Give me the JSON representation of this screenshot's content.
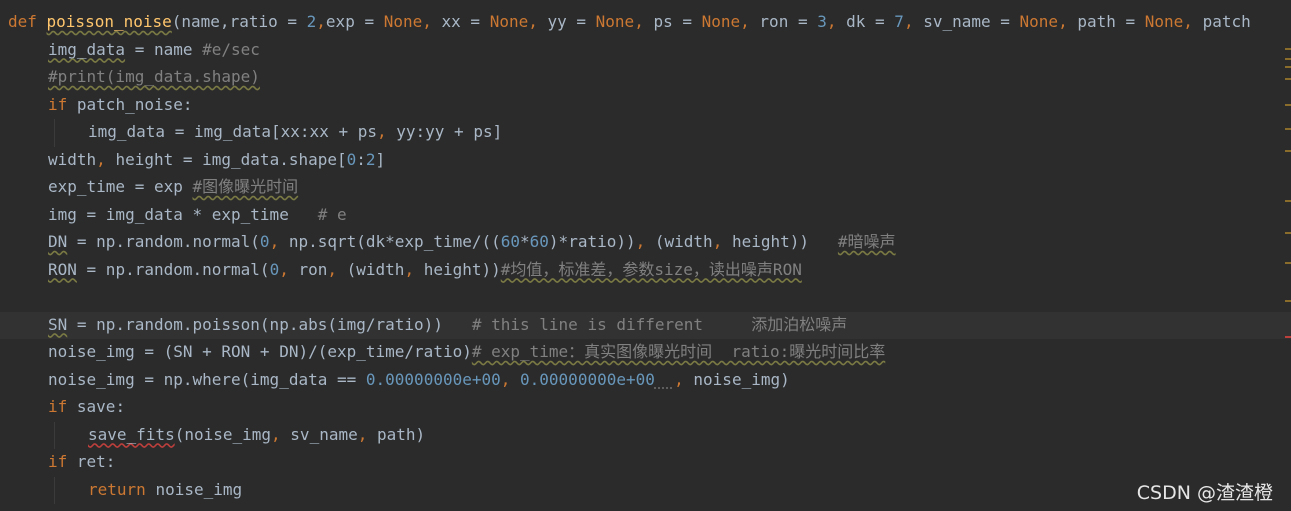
{
  "editor": {
    "lines": [
      {
        "indent": 0,
        "current": false,
        "tokens": [
          {
            "t": "def ",
            "c": "kw"
          },
          {
            "t": "poisson_noise",
            "c": "fn",
            "u": "warn"
          },
          {
            "t": "(name,",
            "c": "txt"
          },
          {
            "t": "ratio",
            "c": "txt"
          },
          {
            "t": " = ",
            "c": "txt"
          },
          {
            "t": "2",
            "c": "num"
          },
          {
            "t": ",",
            "c": "kw"
          },
          {
            "t": "exp = ",
            "c": "txt"
          },
          {
            "t": "None",
            "c": "kw"
          },
          {
            "t": ", ",
            "c": "kw"
          },
          {
            "t": "xx = ",
            "c": "txt"
          },
          {
            "t": "None",
            "c": "kw"
          },
          {
            "t": ", ",
            "c": "kw"
          },
          {
            "t": "yy = ",
            "c": "txt"
          },
          {
            "t": "None",
            "c": "kw"
          },
          {
            "t": ", ",
            "c": "kw"
          },
          {
            "t": "ps = ",
            "c": "txt"
          },
          {
            "t": "None",
            "c": "kw"
          },
          {
            "t": ", ",
            "c": "kw"
          },
          {
            "t": "ron = ",
            "c": "txt"
          },
          {
            "t": "3",
            "c": "num"
          },
          {
            "t": ", ",
            "c": "kw"
          },
          {
            "t": "dk = ",
            "c": "txt"
          },
          {
            "t": "7",
            "c": "num"
          },
          {
            "t": ", ",
            "c": "kw"
          },
          {
            "t": "sv_name = ",
            "c": "txt"
          },
          {
            "t": "None",
            "c": "kw"
          },
          {
            "t": ", ",
            "c": "kw"
          },
          {
            "t": "path = ",
            "c": "txt"
          },
          {
            "t": "None",
            "c": "kw"
          },
          {
            "t": ", ",
            "c": "kw"
          },
          {
            "t": "patch",
            "c": "txt"
          }
        ]
      },
      {
        "indent": 1,
        "current": false,
        "tokens": [
          {
            "t": "img_data",
            "c": "txt",
            "u": "warn"
          },
          {
            "t": " = name ",
            "c": "txt"
          },
          {
            "t": "#e/sec",
            "c": "cm"
          }
        ]
      },
      {
        "indent": 1,
        "current": false,
        "tokens": [
          {
            "t": "#print(img_data.shape)",
            "c": "cm",
            "u": "warn"
          }
        ]
      },
      {
        "indent": 1,
        "current": false,
        "tokens": [
          {
            "t": "if ",
            "c": "kw"
          },
          {
            "t": "patch_noise:",
            "c": "txt"
          }
        ]
      },
      {
        "indent": 2,
        "current": false,
        "tokens": [
          {
            "t": "img_data = img_data[xx:xx + ps",
            "c": "txt"
          },
          {
            "t": ", ",
            "c": "kw"
          },
          {
            "t": "yy:yy + ps]",
            "c": "txt"
          }
        ]
      },
      {
        "indent": 1,
        "current": false,
        "tokens": [
          {
            "t": "width",
            "c": "txt"
          },
          {
            "t": ", ",
            "c": "kw"
          },
          {
            "t": "height = img_data.shape[",
            "c": "txt"
          },
          {
            "t": "0",
            "c": "num"
          },
          {
            "t": ":",
            "c": "txt"
          },
          {
            "t": "2",
            "c": "num"
          },
          {
            "t": "]",
            "c": "txt"
          }
        ]
      },
      {
        "indent": 1,
        "current": false,
        "tokens": [
          {
            "t": "exp_time = exp ",
            "c": "txt"
          },
          {
            "t": "#图像曝光时间",
            "c": "cm",
            "u": "warn"
          }
        ]
      },
      {
        "indent": 1,
        "current": false,
        "tokens": [
          {
            "t": "img = img_data * exp_time   ",
            "c": "txt"
          },
          {
            "t": "# e",
            "c": "cm"
          }
        ]
      },
      {
        "indent": 1,
        "current": false,
        "tokens": [
          {
            "t": "DN",
            "c": "txt",
            "u": "warn"
          },
          {
            "t": " = np.random.normal(",
            "c": "txt"
          },
          {
            "t": "0",
            "c": "num"
          },
          {
            "t": ", ",
            "c": "kw"
          },
          {
            "t": "np.sqrt(dk*exp_time/((",
            "c": "txt"
          },
          {
            "t": "60",
            "c": "num"
          },
          {
            "t": "*",
            "c": "txt"
          },
          {
            "t": "60",
            "c": "num"
          },
          {
            "t": ")*ratio))",
            "c": "txt"
          },
          {
            "t": ", ",
            "c": "kw"
          },
          {
            "t": "(width",
            "c": "txt"
          },
          {
            "t": ", ",
            "c": "kw"
          },
          {
            "t": "height))   ",
            "c": "txt"
          },
          {
            "t": "#暗噪声",
            "c": "cm",
            "u": "warn"
          }
        ]
      },
      {
        "indent": 1,
        "current": false,
        "tokens": [
          {
            "t": "RON",
            "c": "txt",
            "u": "warn"
          },
          {
            "t": " = np.random.normal(",
            "c": "txt"
          },
          {
            "t": "0",
            "c": "num"
          },
          {
            "t": ", ",
            "c": "kw"
          },
          {
            "t": "ron",
            "c": "txt"
          },
          {
            "t": ", ",
            "c": "kw"
          },
          {
            "t": "(width",
            "c": "txt"
          },
          {
            "t": ", ",
            "c": "kw"
          },
          {
            "t": "height))",
            "c": "txt"
          },
          {
            "t": "#均值，标准差，参数size，读出噪声RON",
            "c": "cm",
            "u": "warn"
          }
        ]
      },
      {
        "indent": 0,
        "current": false,
        "tokens": []
      },
      {
        "indent": 1,
        "current": true,
        "tokens": [
          {
            "t": "SN",
            "c": "txt",
            "u": "warn"
          },
          {
            "t": " = np.random.poisson(np.abs(img/ratio))   ",
            "c": "txt"
          },
          {
            "t": "# this line is different     添加泊松噪声",
            "c": "cm"
          }
        ]
      },
      {
        "indent": 1,
        "current": false,
        "tokens": [
          {
            "t": "noise_img = (SN + RON + DN)/(exp_time/ratio)",
            "c": "txt"
          },
          {
            "t": "# exp_time：真实图像曝光时间  ratio:曝光时间比率",
            "c": "cm",
            "u": "warn"
          }
        ]
      },
      {
        "indent": 1,
        "current": false,
        "tokens": [
          {
            "t": "noise_img = np.where(img_data == ",
            "c": "txt"
          },
          {
            "t": "0.00000000e+00",
            "c": "num"
          },
          {
            "t": ", ",
            "c": "kw"
          },
          {
            "t": "0.00000000e+00",
            "c": "num"
          },
          {
            "t": "  ",
            "c": "txt",
            "u": "weak"
          },
          {
            "t": ", ",
            "c": "kw"
          },
          {
            "t": "noise_img)",
            "c": "txt"
          }
        ]
      },
      {
        "indent": 1,
        "current": false,
        "tokens": [
          {
            "t": "if ",
            "c": "kw"
          },
          {
            "t": "save:",
            "c": "txt"
          }
        ]
      },
      {
        "indent": 2,
        "current": false,
        "tokens": [
          {
            "t": "save_fits",
            "c": "txt",
            "u": "err"
          },
          {
            "t": "(noise_img",
            "c": "txt"
          },
          {
            "t": ", ",
            "c": "kw"
          },
          {
            "t": "sv_name",
            "c": "txt"
          },
          {
            "t": ", ",
            "c": "kw"
          },
          {
            "t": "path)",
            "c": "txt"
          }
        ]
      },
      {
        "indent": 1,
        "current": false,
        "tokens": [
          {
            "t": "if ",
            "c": "kw"
          },
          {
            "t": "ret:",
            "c": "txt"
          }
        ]
      },
      {
        "indent": 2,
        "current": false,
        "tokens": [
          {
            "t": "return ",
            "c": "kw"
          },
          {
            "t": "noise_img",
            "c": "txt"
          }
        ]
      }
    ]
  },
  "watermark": "CSDN @渣渣橙",
  "colors": {
    "bg": "#2b2b2b",
    "keyword": "#cc7832",
    "function": "#ffc66d",
    "number": "#6897bb",
    "comment": "#808080",
    "text": "#a9b7c6"
  },
  "scroll_marks": [
    {
      "color": "#8a6d2a"
    },
    {
      "color": "#8a6d2a"
    },
    {
      "color": "#8a6d2a"
    },
    {
      "color": "#8a6d2a"
    },
    {
      "color": "#8a6d2a"
    },
    {
      "color": "#8a6d2a"
    },
    {
      "color": "#8a6d2a"
    },
    {
      "color": "#8a6d2a"
    },
    {
      "color": "#8a6d2a"
    },
    {
      "color": "#8a6d2a"
    },
    {
      "color": "#8a6d2a"
    },
    {
      "color": "#bc3f3c"
    }
  ]
}
